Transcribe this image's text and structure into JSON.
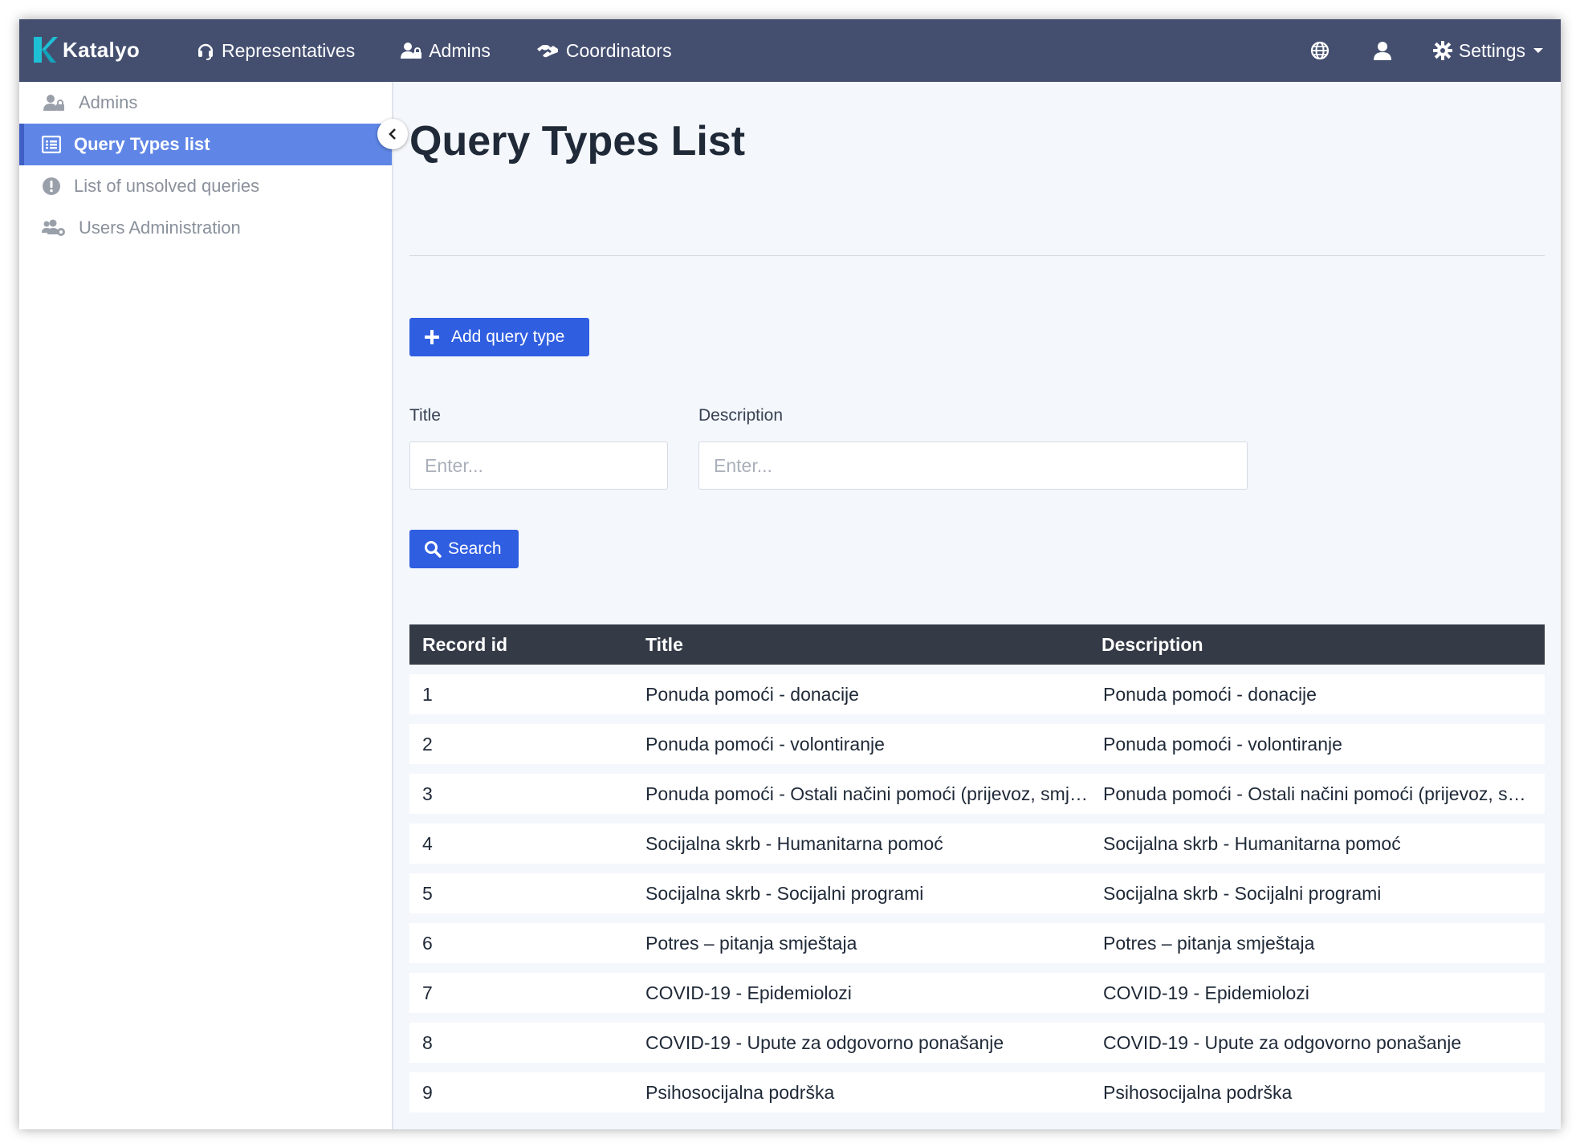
{
  "brand": {
    "name": "Katalyo",
    "accent": "#1ec0d6"
  },
  "nav": {
    "items": [
      {
        "label": "Representatives",
        "icon": "headset-icon"
      },
      {
        "label": "Admins",
        "icon": "user-lock-icon"
      },
      {
        "label": "Coordinators",
        "icon": "handshake-icon"
      }
    ],
    "settings_label": "Settings"
  },
  "sidebar": {
    "items": [
      {
        "label": "Admins",
        "icon": "user-lock-icon",
        "active": false
      },
      {
        "label": "Query Types list",
        "icon": "list-icon",
        "active": true
      },
      {
        "label": "List of unsolved queries",
        "icon": "exclamation-circle-icon",
        "active": false
      },
      {
        "label": "Users Administration",
        "icon": "users-cog-icon",
        "active": false
      }
    ]
  },
  "main": {
    "title": "Query Types List",
    "add_button_label": "Add query type",
    "filters": {
      "title_label": "Title",
      "title_placeholder": "Enter...",
      "description_label": "Description",
      "description_placeholder": "Enter..."
    },
    "search_label": "Search"
  },
  "table": {
    "columns": [
      "Record id",
      "Title",
      "Description"
    ],
    "rows": [
      [
        "1",
        "Ponuda pomoći - donacije",
        "Ponuda pomoći - donacije"
      ],
      [
        "2",
        "Ponuda pomoći - volontiranje",
        "Ponuda pomoći - volontiranje"
      ],
      [
        "3",
        "Ponuda pomoći - Ostali načini pomoći (prijevoz, smještaj...)",
        "Ponuda pomoći - Ostali načini pomoći (prijevoz, smještaj...)"
      ],
      [
        "4",
        "Socijalna skrb - Humanitarna pomoć",
        "Socijalna skrb - Humanitarna pomoć"
      ],
      [
        "5",
        "Socijalna skrb - Socijalni programi",
        "Socijalna skrb - Socijalni programi"
      ],
      [
        "6",
        "Potres – pitanja smještaja",
        "Potres – pitanja smještaja"
      ],
      [
        "7",
        "COVID-19 - Epidemiolozi",
        "COVID-19 - Epidemiolozi"
      ],
      [
        "8",
        "COVID-19 - Upute za odgovorno ponašanje",
        "COVID-19 - Upute za odgovorno ponašanje"
      ],
      [
        "9",
        "Psihosocijalna podrška",
        "Psihosocijalna podrška"
      ]
    ]
  },
  "colors": {
    "navbar": "#444f70",
    "primary": "#2f5ee0",
    "sidebar_active": "#5f86e6",
    "table_header": "#343a46"
  }
}
